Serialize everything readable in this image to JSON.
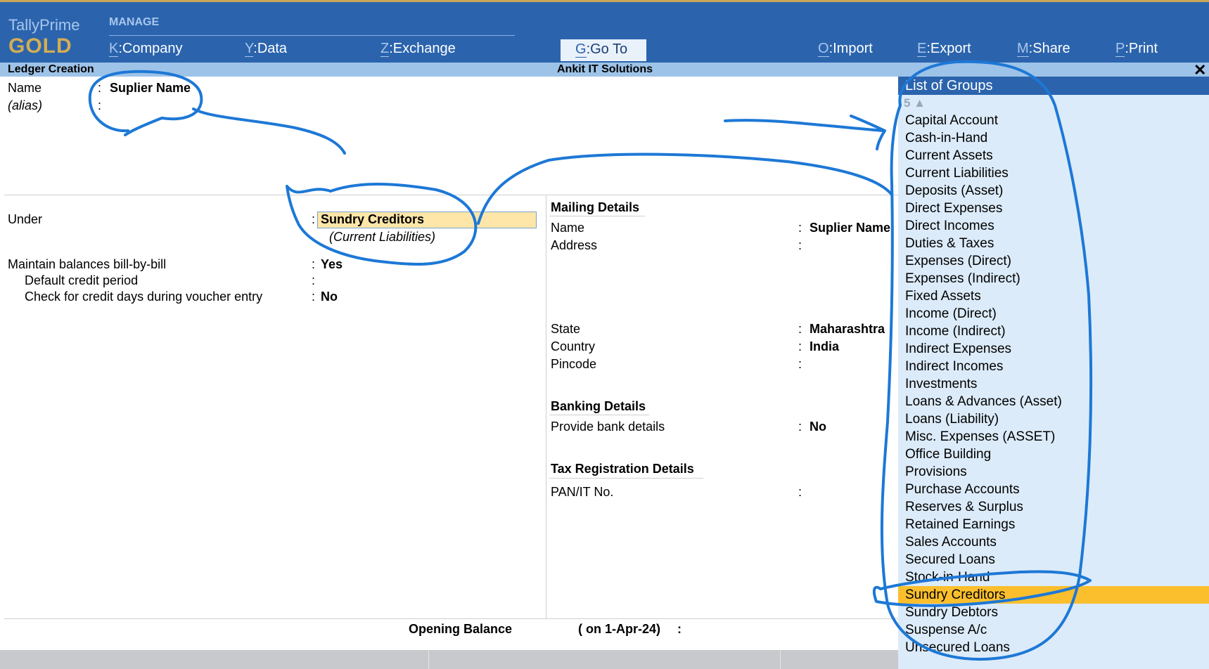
{
  "brand": {
    "product": "TallyPrime",
    "edition": "GOLD"
  },
  "topmenu": {
    "section_label": "MANAGE",
    "items": [
      {
        "key": "K",
        "label": "Company"
      },
      {
        "key": "Y",
        "label": "Data"
      },
      {
        "key": "Z",
        "label": "Exchange"
      },
      {
        "key": "G",
        "label": "Go To"
      },
      {
        "key": "O",
        "label": "Import"
      },
      {
        "key": "E",
        "label": "Export"
      },
      {
        "key": "M",
        "label": "Share"
      },
      {
        "key": "P",
        "label": "Print"
      }
    ]
  },
  "titlebar": {
    "screen": "Ledger Creation",
    "company": "Ankit IT Solutions",
    "close": "✕"
  },
  "ledger": {
    "name_label": "Name",
    "name_value": "Suplier Name",
    "alias_label": "(alias)",
    "colon": ":",
    "under_label": "Under",
    "under_value": "Sundry Creditors",
    "under_parent": "(Current Liabilities)",
    "bill_label": "Maintain balances bill-by-bill",
    "bill_value": "Yes",
    "credit_period_label": "Default credit period",
    "credit_days_label": "Check for credit days during voucher entry",
    "credit_days_value": "No"
  },
  "mailing": {
    "heading": "Mailing Details",
    "name_label": "Name",
    "name_value": "Suplier Name",
    "address_label": "Address",
    "state_label": "State",
    "state_value": "Maharashtra",
    "country_label": "Country",
    "country_value": "India",
    "pincode_label": "Pincode"
  },
  "banking": {
    "heading": "Banking Details",
    "label": "Provide bank details",
    "value": "No"
  },
  "tax": {
    "heading": "Tax Registration Details",
    "pan_label": "PAN/IT No."
  },
  "opening": {
    "label": "Opening Balance",
    "date": "( on 1-Apr-24)",
    "colon": ":"
  },
  "groups": {
    "title": "List of Groups",
    "count": "5 ▲",
    "items": [
      "Capital Account",
      "Cash-in-Hand",
      "Current Assets",
      "Current Liabilities",
      "Deposits (Asset)",
      "Direct Expenses",
      "Direct Incomes",
      "Duties & Taxes",
      "Expenses (Direct)",
      "Expenses (Indirect)",
      "Fixed Assets",
      "Income (Direct)",
      "Income (Indirect)",
      "Indirect Expenses",
      "Indirect Incomes",
      "Investments",
      "Loans & Advances (Asset)",
      "Loans (Liability)",
      "Misc. Expenses (ASSET)",
      "Office Building",
      "Provisions",
      "Purchase Accounts",
      "Reserves & Surplus",
      "Retained Earnings",
      "Sales Accounts",
      "Secured Loans",
      "Stock-in-Hand",
      "Sundry Creditors",
      "Sundry Debtors",
      "Suspense A/c",
      "Unsecured Loans"
    ],
    "selected": "Sundry Creditors"
  },
  "colors": {
    "header": "#2b64ad",
    "selection": "#fbbf2e",
    "panel": "#dcebf9",
    "annotation": "#1d78d6"
  }
}
